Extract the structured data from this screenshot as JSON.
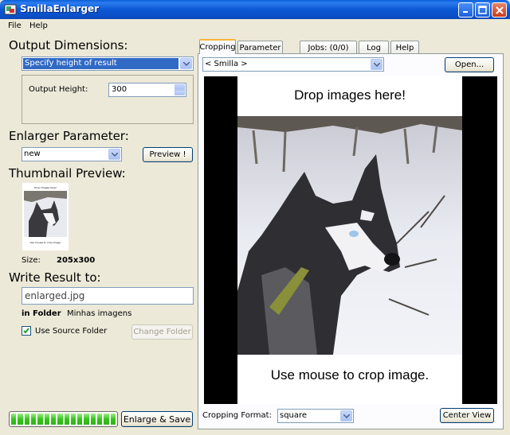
{
  "window": {
    "title": "SmillaEnlarger"
  },
  "menu": [
    "File",
    "Help"
  ],
  "left": {
    "output_heading": "Output Dimensions:",
    "output_mode": "Specify height of result",
    "output_height_label": "Output Height:",
    "output_height_value": "300",
    "enlarger_heading": "Enlarger Parameter:",
    "enlarger_preset": "new",
    "preview_button": "Preview !",
    "thumbnail_heading": "Thumbnail Preview:",
    "size_label": "Size:",
    "size_value": "205x300",
    "write_heading": "Write Result to:",
    "filename": "enlarged.jpg",
    "in_folder_label": "in Folder",
    "folder_name": "Minhas imagens",
    "use_source_label": "Use Source Folder",
    "use_source_checked": true,
    "change_folder_button": "Change Folder",
    "progress_percent": 100,
    "enlarge_button": "Enlarge & Save"
  },
  "right": {
    "tabs": [
      "Cropping",
      "Parameter",
      "Jobs: (0/0)",
      "Log",
      "Help"
    ],
    "active_tab": "Cropping",
    "source_combo": "< Smilla >",
    "open_button": "Open...",
    "drop_text": "Drop images here!",
    "crop_text": "Use mouse to crop image.",
    "cropping_format_label": "Cropping Format:",
    "cropping_format": "square",
    "center_view_button": "Center View"
  },
  "thumbnail": {
    "top_text": "Drop images here!",
    "bottom_text": "Use mouse to crop image."
  },
  "colors": {
    "titlebar": "#0a4fc8",
    "selection": "#316ac5",
    "progress": "#37c31d",
    "active_tab_accent": "#f8b33a"
  }
}
